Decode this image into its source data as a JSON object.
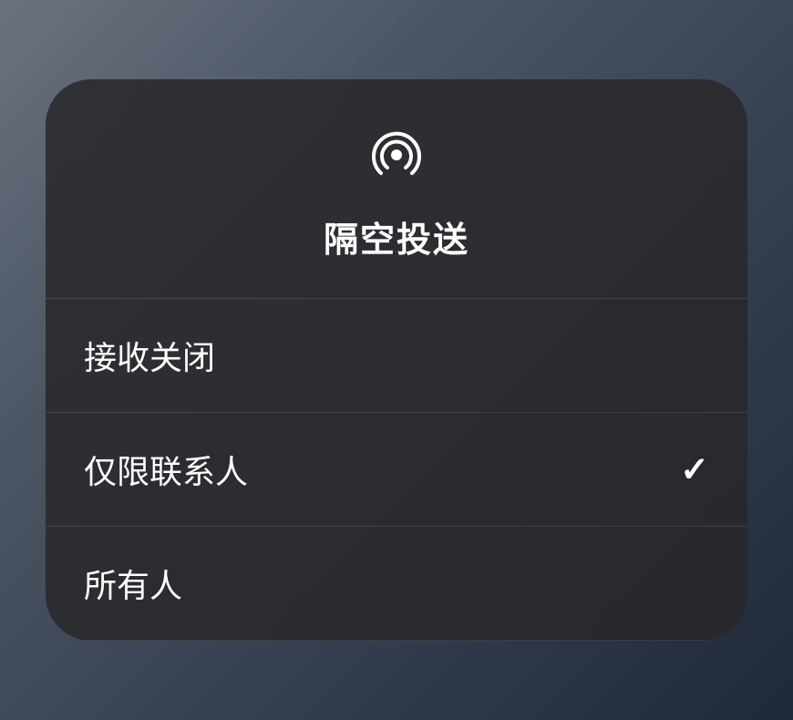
{
  "panel": {
    "title": "隔空投送",
    "options": [
      {
        "label": "接收关闭",
        "selected": false
      },
      {
        "label": "仅限联系人",
        "selected": true
      },
      {
        "label": "所有人",
        "selected": false
      }
    ]
  }
}
